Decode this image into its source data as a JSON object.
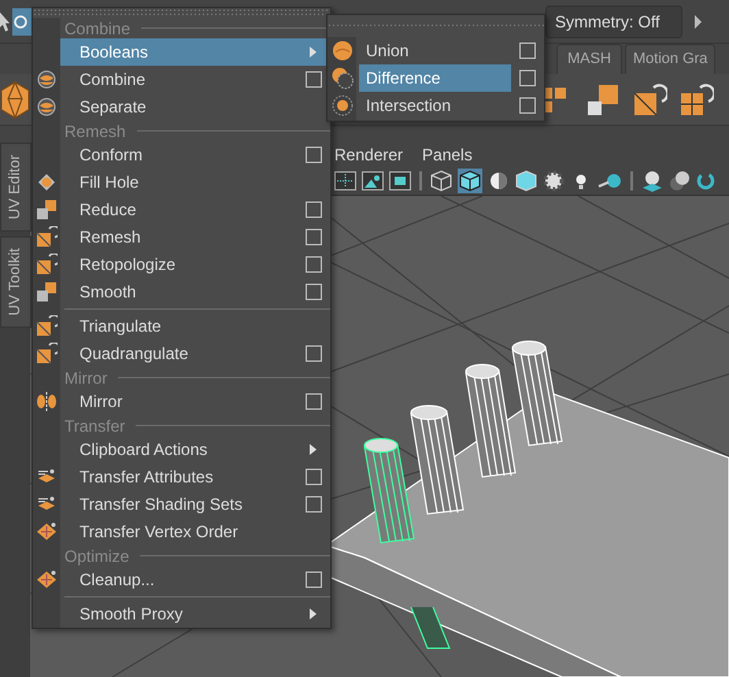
{
  "toolbar": {
    "symmetry": "Symmetry: Off"
  },
  "shelf_tabs": [
    {
      "label": "MASH",
      "selected": false
    },
    {
      "label": "Motion Gra",
      "selected": false
    }
  ],
  "side_tabs": [
    {
      "label": "UV Editor"
    },
    {
      "label": "UV Toolkit"
    }
  ],
  "viewport_menu": [
    "Renderer",
    "Panels"
  ],
  "menu": {
    "sections": [
      {
        "title": "Combine",
        "items": [
          {
            "label": "Booleans",
            "selected": true,
            "submenu": true,
            "option_box": false
          },
          {
            "label": "Combine",
            "selected": false,
            "submenu": false,
            "option_box": true
          },
          {
            "label": "Separate",
            "selected": false,
            "submenu": false,
            "option_box": false
          }
        ]
      },
      {
        "title": "Remesh",
        "items": [
          {
            "label": "Conform",
            "selected": false,
            "submenu": false,
            "option_box": true
          },
          {
            "label": "Fill Hole",
            "selected": false,
            "submenu": false,
            "option_box": false
          },
          {
            "label": "Reduce",
            "selected": false,
            "submenu": false,
            "option_box": true
          },
          {
            "label": "Remesh",
            "selected": false,
            "submenu": false,
            "option_box": true
          },
          {
            "label": "Retopologize",
            "selected": false,
            "submenu": false,
            "option_box": true
          },
          {
            "label": "Smooth",
            "selected": false,
            "submenu": false,
            "option_box": true
          }
        ]
      },
      {
        "items": [
          {
            "label": "Triangulate",
            "selected": false,
            "submenu": false,
            "option_box": false
          },
          {
            "label": "Quadrangulate",
            "selected": false,
            "submenu": false,
            "option_box": true
          }
        ]
      },
      {
        "title": "Mirror",
        "items": [
          {
            "label": "Mirror",
            "selected": false,
            "submenu": false,
            "option_box": true
          }
        ]
      },
      {
        "title": "Transfer",
        "items": [
          {
            "label": "Clipboard Actions",
            "selected": false,
            "submenu": true,
            "option_box": false
          },
          {
            "label": "Transfer Attributes",
            "selected": false,
            "submenu": false,
            "option_box": true
          },
          {
            "label": "Transfer Shading Sets",
            "selected": false,
            "submenu": false,
            "option_box": true
          },
          {
            "label": "Transfer Vertex Order",
            "selected": false,
            "submenu": false,
            "option_box": false
          }
        ]
      },
      {
        "title": "Optimize",
        "items": [
          {
            "label": "Cleanup...",
            "selected": false,
            "submenu": false,
            "option_box": true
          }
        ]
      },
      {
        "items": [
          {
            "label": "Smooth Proxy",
            "selected": false,
            "submenu": true,
            "option_box": false
          }
        ]
      }
    ]
  },
  "submenu": {
    "items": [
      {
        "label": "Union",
        "selected": false,
        "option_box": true
      },
      {
        "label": "Difference",
        "selected": true,
        "option_box": true
      },
      {
        "label": "Intersection",
        "selected": false,
        "option_box": true
      }
    ]
  }
}
